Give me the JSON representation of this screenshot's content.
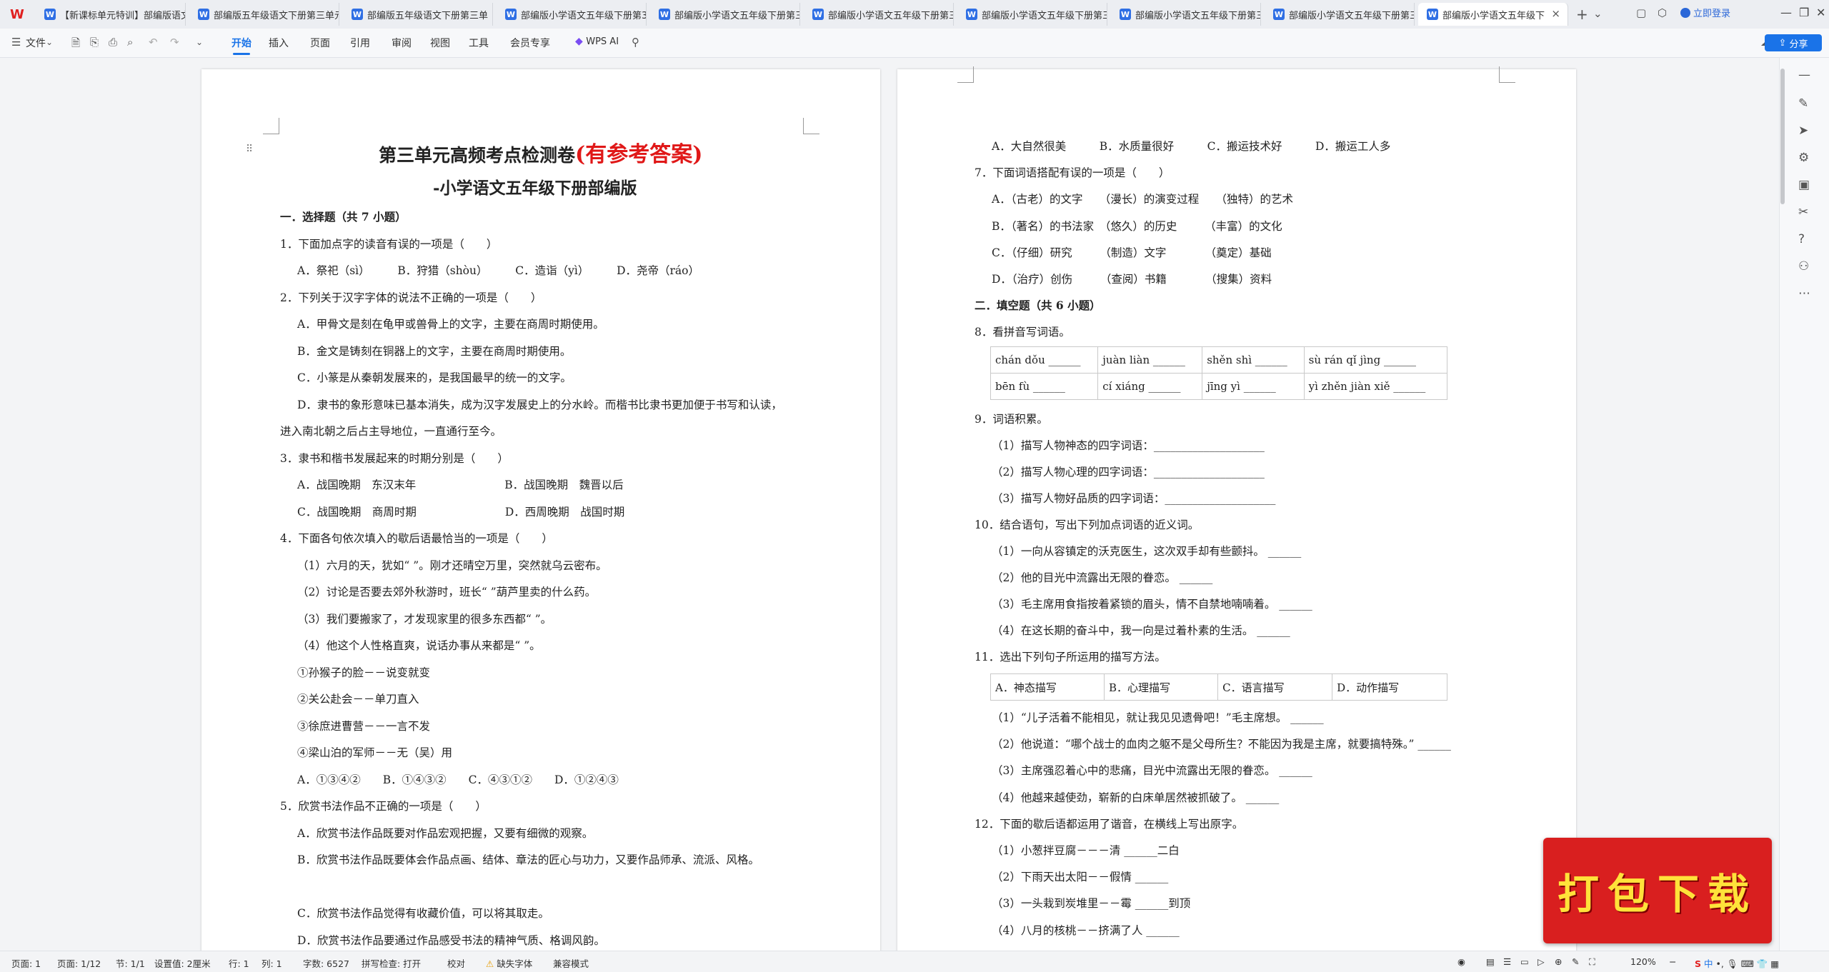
{
  "app": {
    "logo_glyph": "W"
  },
  "tabs": [
    {
      "label": "【新课标单元特训】部编版语文"
    },
    {
      "label": "部编版五年级语文下册第三单元"
    },
    {
      "label": "部编版五年级语文下册第三单"
    },
    {
      "label": "部编版小学语文五年级下册第3单"
    },
    {
      "label": "部编版小学语文五年级下册第三"
    },
    {
      "label": "部编版小学语文五年级下册第三"
    },
    {
      "label": "部编版小学语文五年级下册第三"
    },
    {
      "label": "部编版小学语文五年级下册第三"
    },
    {
      "label": "部编版小学语文五年级下册第三"
    },
    {
      "label": "部编版小学语文五年级下"
    }
  ],
  "header_right": {
    "login": "立即登录",
    "share": "分享"
  },
  "toolbar": {
    "file": "文件",
    "menus": [
      "开始",
      "插入",
      "页面",
      "引用",
      "审阅",
      "视图",
      "工具",
      "会员专享"
    ],
    "ai": "WPS AI"
  },
  "doc": {
    "title_main": "第三单元高频考点检测卷",
    "title_red": "(有参考答案)",
    "subtitle": "-小学语文五年级下册部编版",
    "left": [
      {
        "t": "一．选择题（共 7 小题）",
        "b": true
      },
      {
        "t": "1．下面加点字的读音有误的一项是（　　）"
      },
      {
        "t": "A．祭祀（sì）　　　B．狩猎（shòu）　　　C．造诣（yì）　　　D．尧帝（ráo）",
        "i": 1
      },
      {
        "t": "2．下列关于汉字字体的说法不正确的一项是（　　）"
      },
      {
        "t": "A．甲骨文是刻在龟甲或兽骨上的文字，主要在商周时期使用。",
        "i": 1
      },
      {
        "t": "B．金文是铸刻在铜器上的文字，主要在商周时期使用。",
        "i": 1
      },
      {
        "t": "C．小篆是从秦朝发展来的，是我国最早的统一的文字。",
        "i": 1
      },
      {
        "t": "D．隶书的象形意味已基本消失，成为汉字发展史上的分水岭。而楷书比隶书更加便于书写和认读，",
        "i": 1
      },
      {
        "t": "进入南北朝之后占主导地位，一直通行至今。"
      },
      {
        "t": "3．隶书和楷书发展起来的时期分别是（　　）"
      },
      {
        "t": "A．战国晚期　东汉末年　　　　　　　　B．战国晚期　魏晋以后",
        "i": 1
      },
      {
        "t": "C．战国晚期　商周时期　　　　　　　　D．西周晚期　战国时期",
        "i": 1
      },
      {
        "t": "4．下面各句依次填入的歇后语最恰当的一项是（　　）"
      },
      {
        "t": "（1）六月的天，犹如“ ”。刚才还晴空万里，突然就乌云密布。",
        "i": 1
      },
      {
        "t": "（2）讨论是否要去郊外秋游时，班长“ ”葫芦里卖的什么药。",
        "i": 1
      },
      {
        "t": "（3）我们要搬家了，才发现家里的很多东西都“ ”。",
        "i": 1
      },
      {
        "t": "（4）他这个人性格直爽，说话办事从来都是“ ”。",
        "i": 1
      },
      {
        "t": "①孙猴子的脸－－说变就变",
        "i": 1
      },
      {
        "t": "②关公赴会－－单刀直入",
        "i": 1
      },
      {
        "t": "③徐庶进曹营－－一言不发",
        "i": 1
      },
      {
        "t": "④梁山泊的军师－－无（吴）用",
        "i": 1
      },
      {
        "t": "A．①③④②　　B．①④③②　　C．④③①②　　D．①②④③",
        "i": 1
      },
      {
        "t": "5．欣赏书法作品不正确的一项是（　　）"
      },
      {
        "t": "A．欣赏书法作品既要对作品宏观把握，又要有细微的观察。",
        "i": 1
      },
      {
        "t": "B．欣赏书法作品既要体会作品点画、结体、章法的匠心与功力，又要作品师承、流派、风格。",
        "i": 1
      },
      {
        "t": "",
        "i": 1
      },
      {
        "t": "C．欣赏书法作品觉得有收藏价值，可以将其取走。",
        "i": 1
      },
      {
        "t": "D．欣赏书法作品要通过作品感受书法的精神气质、格调风韵。",
        "i": 1
      }
    ],
    "right_a": [
      {
        "t": "A．大自然很美　　　B．水质量很好　　　C．搬运技术好　　　D．搬运工人多",
        "i": 1
      },
      {
        "t": "7．下面词语搭配有误的一项是（　　）"
      },
      {
        "t": "A．（古老）的文字　　（漫长）的演变过程　　（独特）的艺术",
        "i": 1
      },
      {
        "t": "B．（著名）的书法家　（悠久）的历史　　　（丰富）的文化",
        "i": 1
      },
      {
        "t": "C．（仔细）研究　　　（制造）文字　　　　（奠定）基础",
        "i": 1
      },
      {
        "t": "D．（治疗）创伤　　　（查阅）书籍　　　　（搜集）资料",
        "i": 1
      },
      {
        "t": "二．填空题（共 6 小题）",
        "b": true
      },
      {
        "t": "8．看拼音写词语。"
      }
    ],
    "pinyin_table": [
      [
        "chán dǒu ______",
        "juàn liàn ______",
        "shěn shì ______",
        "sù rán qǐ jìng ______"
      ],
      [
        "bēn fù ______",
        "cí xiáng ______",
        "jīng yì ______",
        "yì zhěn jiàn xiě ______"
      ]
    ],
    "right_b": [
      {
        "t": "9．词语积累。"
      },
      {
        "t": "（1）描写人物神态的四字词语：____________________",
        "i": 1
      },
      {
        "t": "（2）描写人物心理的四字词语：____________________",
        "i": 1
      },
      {
        "t": "（3）描写人物好品质的四字词语：____________________",
        "i": 1
      },
      {
        "t": "10．结合语句，写出下列加点词语的近义词。"
      },
      {
        "t": "（1）一向从容镇定的沃克医生，这次双手却有些颤抖。 ______",
        "i": 1
      },
      {
        "t": "（2）他的目光中流露出无限的眷恋。 ______",
        "i": 1
      },
      {
        "t": "（3）毛主席用食指按着紧锁的眉头，情不自禁地喃喃着。 ______",
        "i": 1
      },
      {
        "t": "（4）在这长期的奋斗中，我一向是过着朴素的生活。 ______",
        "i": 1
      },
      {
        "t": "11．选出下列句子所运用的描写方法。"
      }
    ],
    "method_table": [
      [
        "A．神态描写",
        "B．心理描写",
        "C．语言描写",
        "D．动作描写"
      ]
    ],
    "right_c": [
      {
        "t": "（1）“儿子活着不能相见，就让我见见遗骨吧！”毛主席想。 ______",
        "i": 1
      },
      {
        "t": "（2）他说道：“哪个战士的血肉之躯不是父母所生？不能因为我是主席，就要搞特殊。” ______",
        "i": 1
      },
      {
        "t": "（3）主席强忍着心中的悲痛，目光中流露出无限的眷恋。 ______",
        "i": 1
      },
      {
        "t": "（4）他越来越使劲，崭新的白床单居然被抓破了。 ______",
        "i": 1
      },
      {
        "t": "12．下面的歇后语都运用了谐音，在横线上写出原字。"
      },
      {
        "t": "（1）小葱拌豆腐－－－清 ______二白",
        "i": 1
      },
      {
        "t": "（2）下雨天出太阳－－假情 ______",
        "i": 1
      },
      {
        "t": "（3）一头栽到炭堆里－－霉 ______到顶",
        "i": 1
      },
      {
        "t": "（4）八月的核桃－－挤满了人 ______",
        "i": 1
      }
    ]
  },
  "promo": {
    "text": "打包下载"
  },
  "status": {
    "page": "页面: 1",
    "pages": "页面: 1/12",
    "section": "节: 1/1",
    "setting": "设置值: 2厘米",
    "row": "行: 1",
    "col": "列: 1",
    "words": "字数: 6527",
    "spell": "拼写检查: 打开",
    "proof": "校对",
    "missing_font": "缺失字体",
    "compat": "兼容模式",
    "zoom": "120%"
  }
}
